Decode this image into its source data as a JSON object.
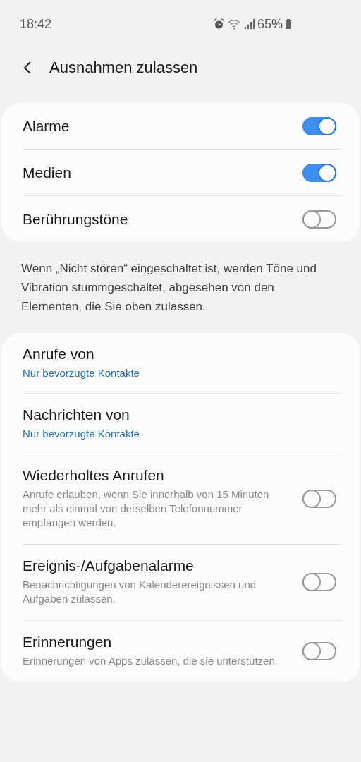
{
  "status_bar": {
    "time": "18:42",
    "battery": "65%"
  },
  "header": {
    "title": "Ausnahmen zulassen"
  },
  "sound_items": [
    {
      "kind": "toggle",
      "label": "Alarme",
      "on": true
    },
    {
      "kind": "toggle",
      "label": "Medien",
      "on": true
    },
    {
      "kind": "toggle",
      "label": "Berührungstöne",
      "on": false
    }
  ],
  "description": "Wenn „Nicht stören“ eingeschaltet ist, werden Töne und Vibration stummgeschaltet, abgesehen von den Elementen, die Sie oben zulassen.",
  "exception_items": [
    {
      "kind": "choice",
      "label": "Anrufe von",
      "value": "Nur bevorzugte Kontakte"
    },
    {
      "kind": "choice",
      "label": "Nachrichten von",
      "value": "Nur bevorzugte Kontakte"
    },
    {
      "kind": "toggle",
      "label": "Wiederholtes Anrufen",
      "summary": "Anrufe erlauben, wenn Sie innerhalb von 15 Minuten mehr als einmal von derselben Telefonnummer empfangen werden.",
      "on": false
    },
    {
      "kind": "toggle",
      "label": "Ereignis-/Aufgabenalarme",
      "summary": "Benachrichtigungen von Kalenderereignissen und Aufgaben zulassen.",
      "on": false
    },
    {
      "kind": "toggle",
      "label": "Erinnerungen",
      "summary": "Erinnerungen von Apps zulassen, die sie unterstützen.",
      "on": false
    }
  ]
}
